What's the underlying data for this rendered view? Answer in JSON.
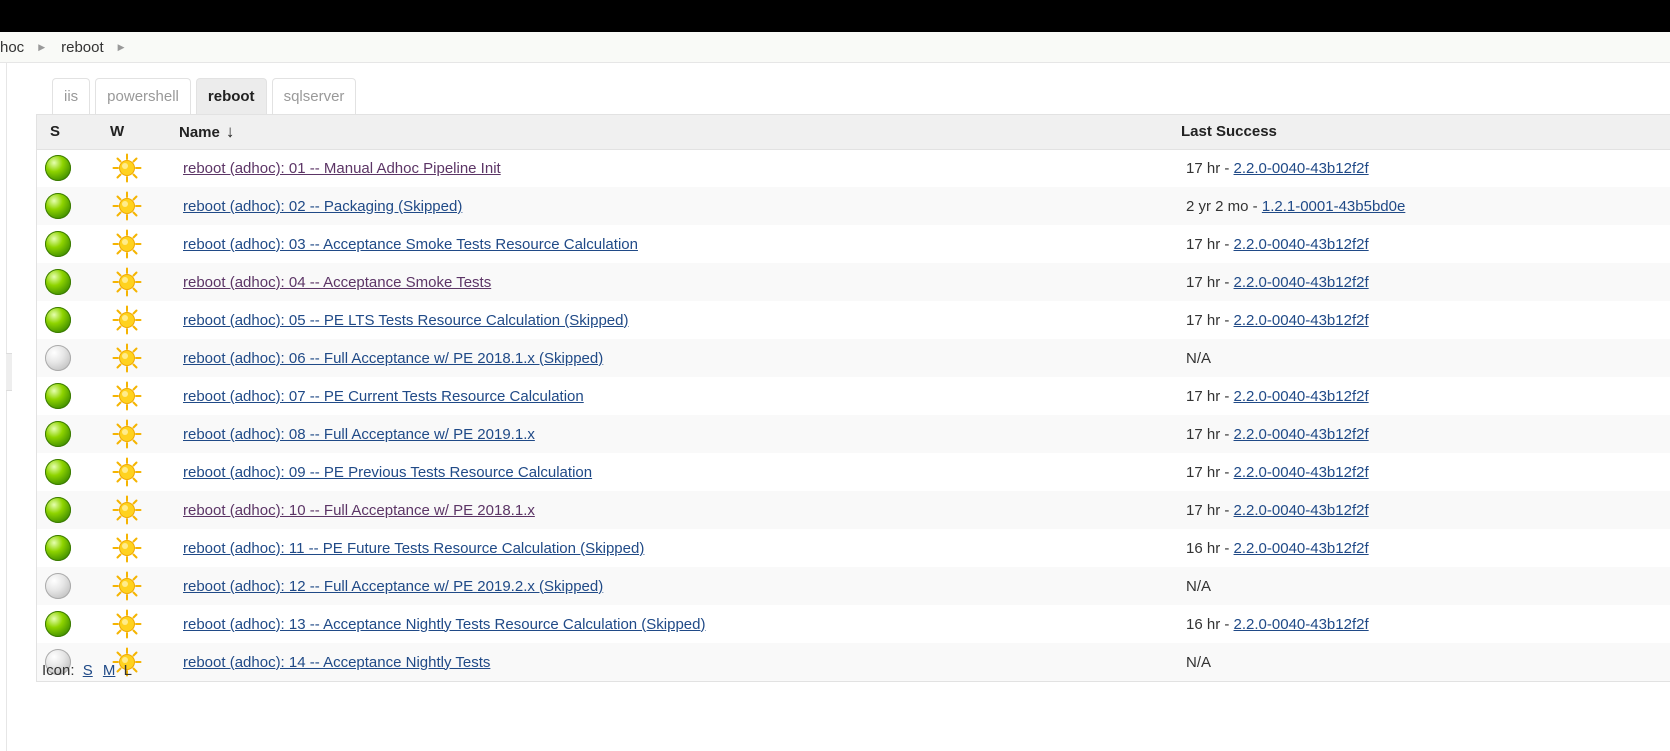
{
  "breadcrumb": [
    "hoc",
    "reboot"
  ],
  "tabs": [
    {
      "label": "iis",
      "active": false
    },
    {
      "label": "powershell",
      "active": false
    },
    {
      "label": "reboot",
      "active": true
    },
    {
      "label": "sqlserver",
      "active": false
    }
  ],
  "table": {
    "headers": {
      "s": "S",
      "w": "W",
      "name": "Name",
      "sort_indicator": "↓",
      "last_success": "Last Success"
    },
    "rows": [
      {
        "status": "green",
        "weather": "sunny",
        "name": "reboot (adhoc): 01 -- Manual Adhoc Pipeline Init",
        "visited": true,
        "last_time": "17 hr - ",
        "last_build": "2.2.0-0040-43b12f2f"
      },
      {
        "status": "green",
        "weather": "sunny",
        "name": "reboot (adhoc): 02 -- Packaging (Skipped)",
        "visited": false,
        "last_time": "2 yr 2 mo - ",
        "last_build": "1.2.1-0001-43b5bd0e"
      },
      {
        "status": "green",
        "weather": "sunny",
        "name": "reboot (adhoc): 03 -- Acceptance Smoke Tests Resource Calculation",
        "visited": false,
        "last_time": "17 hr - ",
        "last_build": "2.2.0-0040-43b12f2f"
      },
      {
        "status": "green",
        "weather": "sunny",
        "name": "reboot (adhoc): 04 -- Acceptance Smoke Tests",
        "visited": true,
        "last_time": "17 hr - ",
        "last_build": "2.2.0-0040-43b12f2f"
      },
      {
        "status": "green",
        "weather": "sunny",
        "name": "reboot (adhoc): 05 -- PE LTS Tests Resource Calculation (Skipped)",
        "visited": false,
        "last_time": "17 hr - ",
        "last_build": "2.2.0-0040-43b12f2f"
      },
      {
        "status": "grey",
        "weather": "sunny",
        "name": "reboot (adhoc): 06 -- Full Acceptance w/ PE 2018.1.x (Skipped)",
        "visited": false,
        "last_time": "N/A",
        "last_build": ""
      },
      {
        "status": "green",
        "weather": "sunny",
        "name": "reboot (adhoc): 07 -- PE Current Tests Resource Calculation",
        "visited": false,
        "last_time": "17 hr - ",
        "last_build": "2.2.0-0040-43b12f2f"
      },
      {
        "status": "green",
        "weather": "sunny",
        "name": "reboot (adhoc): 08 -- Full Acceptance w/ PE 2019.1.x",
        "visited": false,
        "last_time": "17 hr - ",
        "last_build": "2.2.0-0040-43b12f2f"
      },
      {
        "status": "green",
        "weather": "sunny",
        "name": "reboot (adhoc): 09 -- PE Previous Tests Resource Calculation",
        "visited": false,
        "last_time": "17 hr - ",
        "last_build": "2.2.0-0040-43b12f2f"
      },
      {
        "status": "green",
        "weather": "sunny",
        "name": "reboot (adhoc): 10 -- Full Acceptance w/ PE 2018.1.x",
        "visited": true,
        "last_time": "17 hr - ",
        "last_build": "2.2.0-0040-43b12f2f"
      },
      {
        "status": "green",
        "weather": "sunny",
        "name": "reboot (adhoc): 11 -- PE Future Tests Resource Calculation (Skipped)",
        "visited": false,
        "last_time": "16 hr - ",
        "last_build": "2.2.0-0040-43b12f2f"
      },
      {
        "status": "grey",
        "weather": "sunny",
        "name": "reboot (adhoc): 12 -- Full Acceptance w/ PE 2019.2.x (Skipped)",
        "visited": false,
        "last_time": "N/A",
        "last_build": ""
      },
      {
        "status": "green",
        "weather": "sunny",
        "name": "reboot (adhoc): 13 -- Acceptance Nightly Tests Resource Calculation (Skipped)",
        "visited": false,
        "last_time": "16 hr - ",
        "last_build": "2.2.0-0040-43b12f2f"
      },
      {
        "status": "grey",
        "weather": "sunny",
        "name": "reboot (adhoc): 14 -- Acceptance Nightly Tests",
        "visited": false,
        "last_time": "N/A",
        "last_build": ""
      }
    ]
  },
  "icon_size": {
    "label": "Icon:",
    "options": [
      "S",
      "M",
      "L"
    ],
    "current": "L"
  },
  "colors": {
    "link": "#204a87",
    "visited_link": "#5c3566",
    "header_bg": "#f0f0f0",
    "topbar": "#000000"
  }
}
